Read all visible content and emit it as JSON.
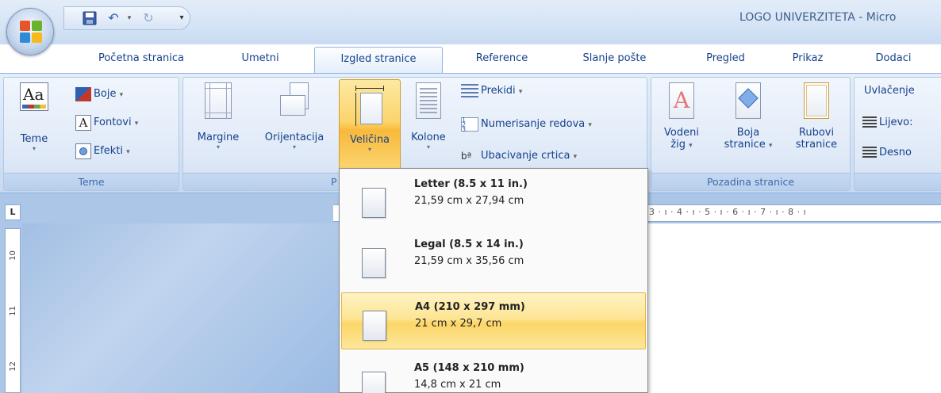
{
  "window": {
    "title": "LOGO UNIVERZITETA - Micro"
  },
  "tabs": [
    {
      "label": "Početna stranica"
    },
    {
      "label": "Umetni"
    },
    {
      "label": "Izgled stranice"
    },
    {
      "label": "Reference"
    },
    {
      "label": "Slanje pošte"
    },
    {
      "label": "Pregled"
    },
    {
      "label": "Prikaz"
    },
    {
      "label": "Dodaci"
    }
  ],
  "active_tab": "Izgled stranice",
  "ribbon": {
    "teme_group": {
      "label": "Teme",
      "teme_button": "Teme",
      "boje": "Boje",
      "fontovi": "Fontovi",
      "efekti": "Efekti"
    },
    "page_setup_group": {
      "label_visible": "P",
      "margine": "Margine",
      "orijentacija": "Orijentacija",
      "velicina": "Veličina",
      "kolone": "Kolone",
      "prekidi": "Prekidi",
      "numerisanje": "Numerisanje redova",
      "ubacivanje": "Ubacivanje crtica"
    },
    "pozadina_group": {
      "label": "Pozadina stranice",
      "vodeni_line1": "Vodeni",
      "vodeni_line2": "žig",
      "boja_line1": "Boja",
      "boja_line2": "stranice",
      "rubovi_line1": "Rubovi",
      "rubovi_line2": "stranice"
    },
    "paragraph_group": {
      "uvlacenje": "Uvlačenje",
      "lijevo": "Lijevo:",
      "desno": "Desno"
    }
  },
  "ruler": {
    "corner": "L",
    "h_numbers": "3 · ı · 4 · ı · 5 · ı · 6 · ı · 7 · ı · 8 · ı",
    "v_numbers": [
      "10",
      "11",
      "12"
    ]
  },
  "size_dropdown": {
    "items": [
      {
        "title": "Letter (8.5 x 11 in.)",
        "dims": "21,59 cm x 27,94 cm",
        "selected": false
      },
      {
        "title": "Legal (8.5 x 14 in.)",
        "dims": "21,59 cm x 35,56 cm",
        "selected": false
      },
      {
        "title": "A4 (210 x 297 mm)",
        "dims": "21 cm x 29,7 cm",
        "selected": true
      },
      {
        "title": "A5 (148 x 210 mm)",
        "dims": "14,8 cm x 21 cm",
        "selected": false
      }
    ]
  },
  "colors": {
    "accent": "#15428b",
    "highlight": "#fcd667",
    "ribbon_bg": "#d5e3f5"
  }
}
